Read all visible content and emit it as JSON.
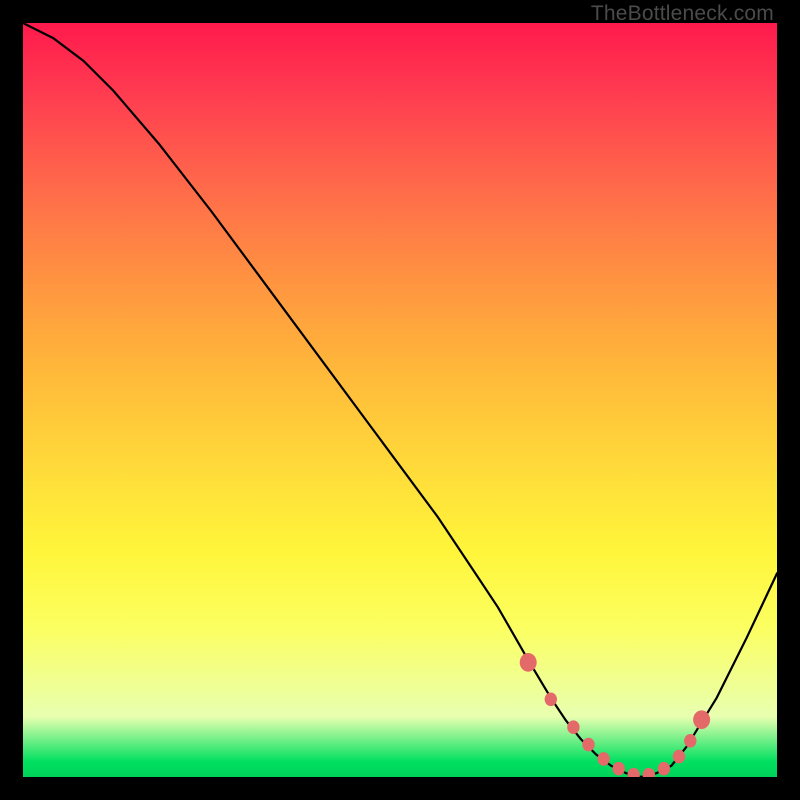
{
  "watermark": "TheBottleneck.com",
  "chart_data": {
    "type": "line",
    "title": "",
    "xlabel": "",
    "ylabel": "",
    "xlim": [
      0,
      100
    ],
    "ylim": [
      0,
      100
    ],
    "series": [
      {
        "name": "bottleneck-curve",
        "x": [
          0,
          4,
          8,
          12,
          18,
          25,
          35,
          45,
          55,
          60,
          63,
          65,
          67,
          70,
          72,
          74,
          76,
          78,
          80,
          82,
          84,
          86,
          88,
          92,
          96,
          100
        ],
        "values": [
          100,
          98,
          95,
          91,
          84,
          75,
          61.5,
          48,
          34.5,
          27,
          22.5,
          19,
          15.5,
          10.5,
          7.5,
          5,
          3,
          1.5,
          0.5,
          0,
          0.5,
          1.5,
          4,
          10.5,
          18.5,
          27
        ]
      }
    ],
    "markers": {
      "name": "highlight-dots",
      "color": "#e46a6a",
      "x": [
        67,
        70,
        73,
        75,
        77,
        79,
        81,
        83,
        85,
        87,
        88.5,
        90
      ],
      "values": [
        15.2,
        10.3,
        6.6,
        4.3,
        2.4,
        1.1,
        0.3,
        0.3,
        1.1,
        2.7,
        4.8,
        7.6
      ]
    }
  }
}
